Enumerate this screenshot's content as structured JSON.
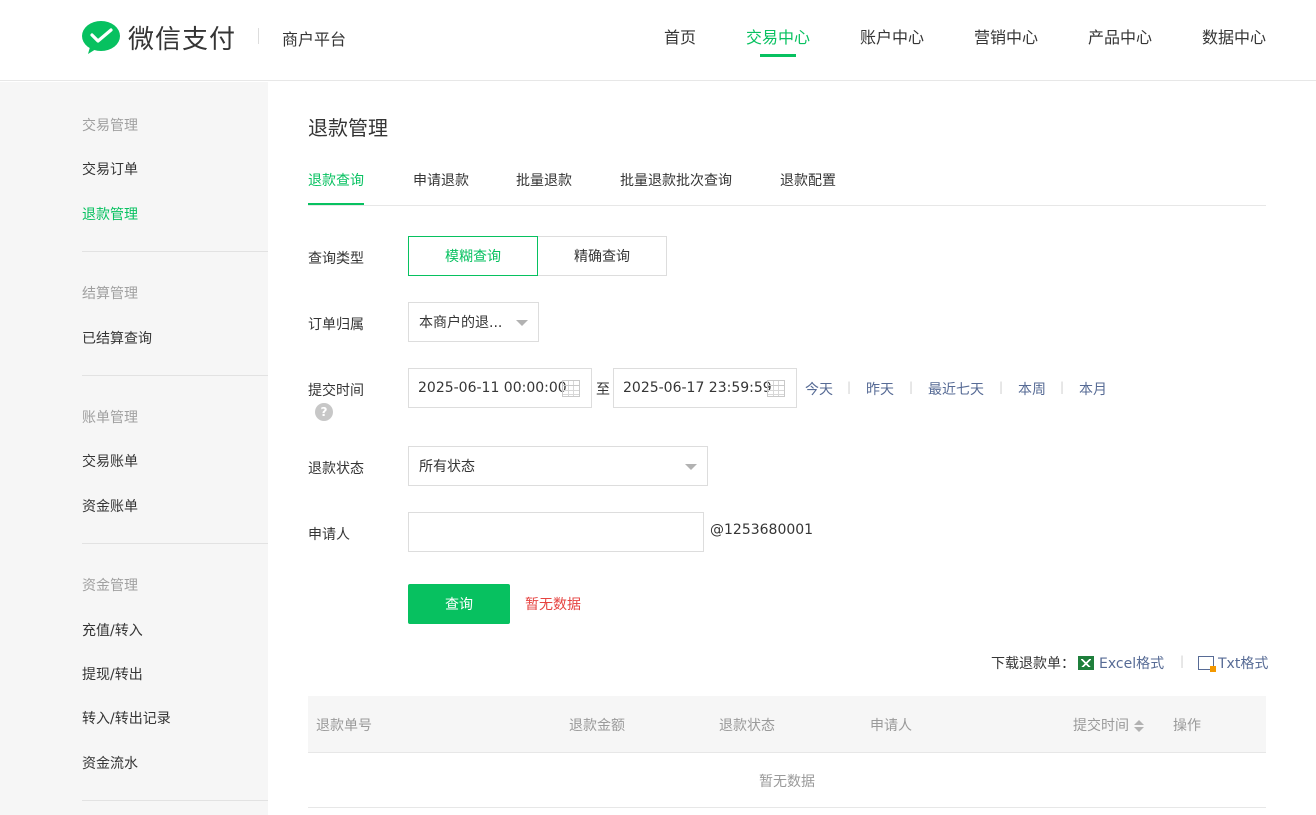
{
  "header": {
    "brand": "微信支付",
    "platform": "商户平台",
    "nav": [
      "首页",
      "交易中心",
      "账户中心",
      "营销中心",
      "产品中心",
      "数据中心"
    ],
    "active_nav": "交易中心"
  },
  "sidebar": {
    "groups": [
      {
        "title": "交易管理",
        "items": [
          "交易订单",
          "退款管理"
        ]
      },
      {
        "title": "结算管理",
        "items": [
          "已结算查询"
        ]
      },
      {
        "title": "账单管理",
        "items": [
          "交易账单",
          "资金账单"
        ]
      },
      {
        "title": "资金管理",
        "items": [
          "充值/转入",
          "提现/转出",
          "转入/转出记录",
          "资金流水"
        ]
      }
    ],
    "active_item": "退款管理"
  },
  "page": {
    "title": "退款管理",
    "tabs": [
      "退款查询",
      "申请退款",
      "批量退款",
      "批量退款批次查询",
      "退款配置"
    ],
    "active_tab": "退款查询"
  },
  "form": {
    "query_type": {
      "label": "查询类型",
      "options": [
        "模糊查询",
        "精确查询"
      ],
      "selected": "模糊查询"
    },
    "order_owner": {
      "label": "订单归属",
      "value": "本商户的退..."
    },
    "submit_time": {
      "label": "提交时间",
      "start": "2025-06-11 00:00:00",
      "to": "至",
      "end": "2025-06-17 23:59:59",
      "quick": [
        "今天",
        "昨天",
        "最近七天",
        "本周",
        "本月"
      ],
      "help": "?"
    },
    "refund_status": {
      "label": "退款状态",
      "value": "所有状态"
    },
    "applicant": {
      "label": "申请人",
      "value": "",
      "suffix": "@1253680001"
    },
    "submit_label": "查询",
    "no_data_notice": "暂无数据"
  },
  "download": {
    "label": "下载退款单：",
    "excel": "Excel格式",
    "txt": "Txt格式",
    "separator": "|"
  },
  "table": {
    "columns": [
      "退款单号",
      "退款金额",
      "退款状态",
      "申请人",
      "提交时间",
      "操作"
    ],
    "empty": "暂无数据"
  },
  "colors": {
    "accent": "#07c160",
    "link": "#576b95",
    "error": "#e64340"
  }
}
